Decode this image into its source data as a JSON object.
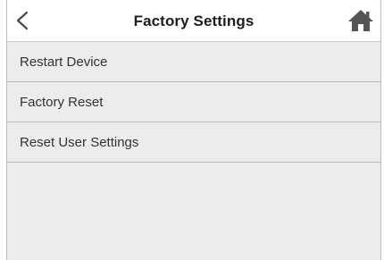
{
  "header": {
    "title": "Factory Settings",
    "back_icon": "chevron-left-icon",
    "home_icon": "home-icon"
  },
  "menu": {
    "items": [
      {
        "label": "Restart Device"
      },
      {
        "label": "Factory Reset"
      },
      {
        "label": "Reset User Settings"
      }
    ]
  },
  "colors": {
    "header_bg": "#ffffff",
    "list_bg": "#ececec",
    "divider": "#bdbdbd",
    "text": "#333333",
    "icon": "#555555"
  }
}
